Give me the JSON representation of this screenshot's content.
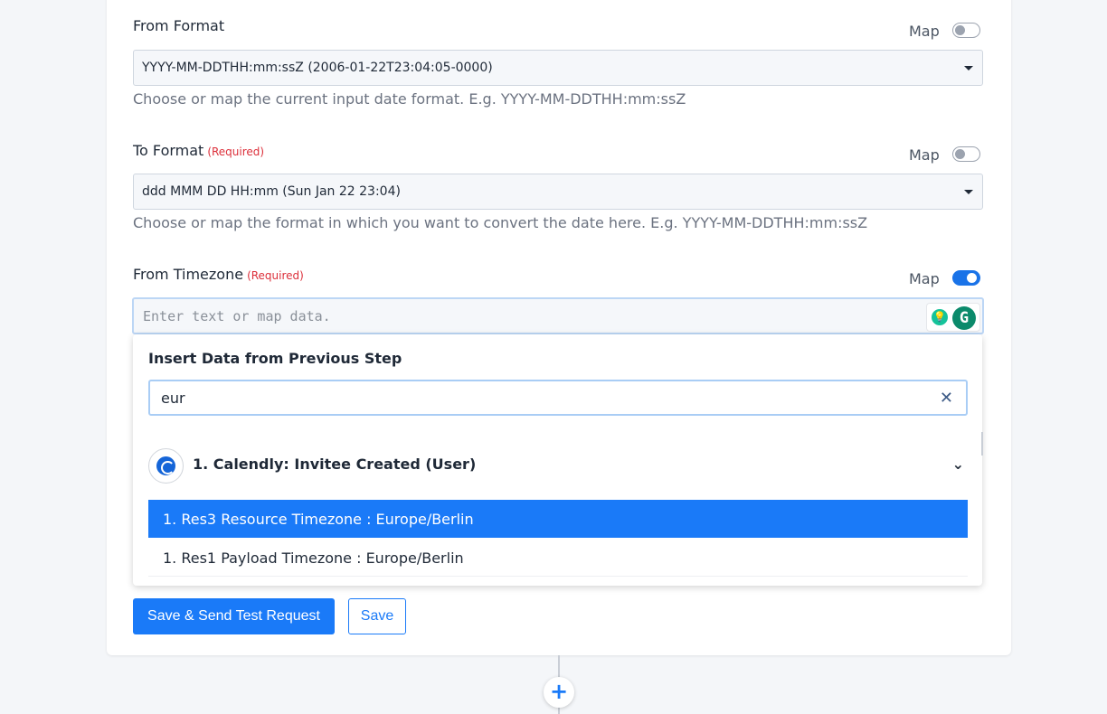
{
  "from_format": {
    "label": "From Format",
    "map_label": "Map",
    "map_on": false,
    "value": "YYYY-MM-DDTHH:mm:ssZ (2006-01-22T23:04:05-0000)",
    "help": "Choose or map the current input date format. E.g. YYYY-MM-DDTHH:mm:ssZ"
  },
  "to_format": {
    "label": "To Format",
    "required": "(Required)",
    "map_label": "Map",
    "map_on": false,
    "value": "ddd MMM DD HH:mm (Sun Jan 22 23:04)",
    "help": "Choose or map the format in which you want to convert the date here. E.g. YYYY-MM-DDTHH:mm:ssZ"
  },
  "from_timezone": {
    "label": "From Timezone",
    "required": "(Required)",
    "map_label": "Map",
    "map_on": true,
    "placeholder": "Enter text or map data."
  },
  "insert_panel": {
    "title": "Insert Data from Previous Step",
    "search_value": "eur",
    "group_title": "1. Calendly: Invitee Created (User)",
    "options": [
      {
        "label": "1. Res3 Resource Timezone : Europe/Berlin",
        "active": true
      },
      {
        "label": "1. Res1 Payload Timezone : Europe/Berlin",
        "active": false
      }
    ]
  },
  "actions": {
    "save_test_label": "Save & Send Test Request",
    "save_label": "Save"
  },
  "icons": {
    "add": "+",
    "clear": "✕",
    "chevron": "⌄",
    "grammarly": "G",
    "bulb": "💡"
  },
  "colors": {
    "accent": "#1a7af8",
    "required": "#dc2f3a",
    "active_option": "#1a7af8"
  }
}
